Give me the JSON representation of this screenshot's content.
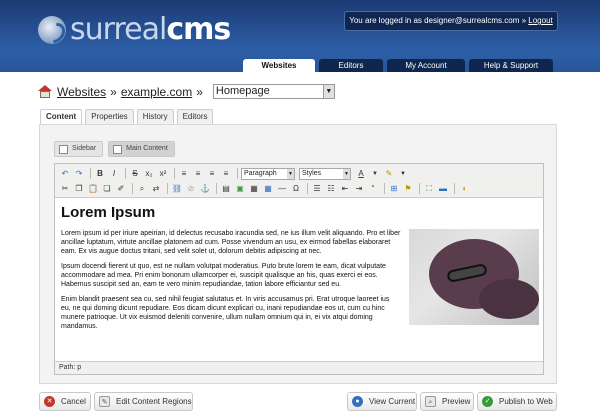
{
  "header": {
    "logo_text_light": "surreal",
    "logo_text_bold": "cms",
    "login_prefix": "You are logged in as designer@surrealcms.com »",
    "logout_label": "Logout",
    "nav": [
      {
        "label": "Websites"
      },
      {
        "label": "Editors"
      },
      {
        "label": "My Account"
      },
      {
        "label": "Help & Support"
      }
    ]
  },
  "breadcrumb": {
    "websites": "Websites",
    "sep1": "»",
    "site": "example.com",
    "sep2": "»",
    "page_selected": "Homepage"
  },
  "editor_tabs": [
    {
      "label": "Content"
    },
    {
      "label": "Properties"
    },
    {
      "label": "History"
    },
    {
      "label": "Editors"
    }
  ],
  "regions": [
    {
      "label": "Sidebar"
    },
    {
      "label": "Main Content"
    }
  ],
  "toolbar": {
    "format_select": "Paragraph",
    "styles_select": "Styles"
  },
  "content": {
    "heading": "Lorem Ipsum",
    "p1": "Lorem ipsum id per iriure apeirian, id delectus recusabo iracundia sed, ne ius illum velit aliquando. Pro et liber ancillae luptatum, virtute ancillae platonem ad cum. Posse vivendum an usu, ex eirmod fabellas elaboraret eam. Ex vis augue doctus tritani, sed velit solet ut, dolorum debitis adipiscing at nec.",
    "p2": "Ipsum docendi fierent ut quo, est ne nullam volutpat moderatius. Puto brute lorem te eam, dicat vulputate accommodare ad mea. Pri enim bonorum ullamcorper ei, suscipit qualisque an his, quas exerci ei eos. Habemus suscipit sed an, eam te vero minim repudiandae, tation labore efficiantur sed eu.",
    "p3": "Enim blandit praesent sea cu, sed nihil feugiat salutatus et. In viris accusamus pri. Erat utroque laoreet ius eu, ne qui doming dicunt repudiare. Eos dicam dicunt explicari cu, inani repudiandae eos ut, cum cu hinc munere patrioque. Ut vix euismod deleniti convenire, ullum nullam omnium qui in, ei vix atqui doming mandamus.",
    "path_label": "Path: p"
  },
  "footer": {
    "cancel": "Cancel",
    "edit_regions": "Edit Content Regions",
    "view_current": "View Current",
    "preview": "Preview",
    "publish": "Publish to Web"
  },
  "colors": {
    "header_blue": "#2d5fa8",
    "nav_dark": "#0f2650",
    "cancel_red": "#c0392b",
    "publish_green": "#3a9a3a",
    "view_blue": "#2f6fbf"
  }
}
